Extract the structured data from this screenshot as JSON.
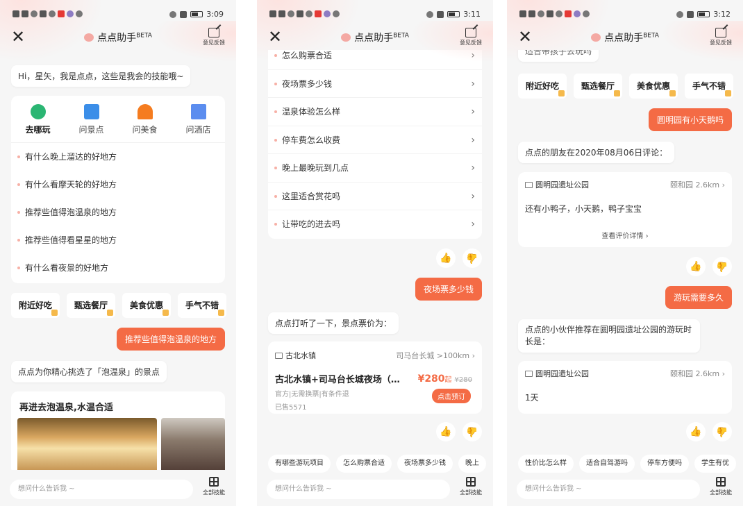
{
  "common": {
    "title": "点点助手",
    "title_sup": "BETA",
    "feedback_label": "意见反馈",
    "input_placeholder": "想问什么告诉我 ~",
    "all_skills_label": "全部技能",
    "close_symbol": "✕",
    "chevron": "›",
    "thumb_up": "👍",
    "thumb_down": "👍"
  },
  "screens": [
    {
      "time": "3:09",
      "greeting": "Hi，星矢，我是点点，这些是我会的技能哦~",
      "tabs": [
        {
          "label": "去哪玩",
          "icon": "compass-icon",
          "color": "#2bb673"
        },
        {
          "label": "问景点",
          "icon": "signpost-icon",
          "color": "#3b8ee8"
        },
        {
          "label": "问美食",
          "icon": "food-dome-icon",
          "color": "#f57c1f"
        },
        {
          "label": "问酒店",
          "icon": "hotel-icon",
          "color": "#5b8def"
        }
      ],
      "questions": [
        "有什么晚上溜达的好地方",
        "有什么看摩天轮的好地方",
        "推荐些值得泡温泉的地方",
        "推荐些值得看星星的地方",
        "有什么看夜景的好地方"
      ],
      "chips": [
        "附近好吃",
        "甄选餐厅",
        "美食优惠",
        "手气不错"
      ],
      "user_msg": "推荐些值得泡温泉的地方",
      "bot_msg": "点点为你精心挑选了「泡温泉」的景点",
      "result_title": "再进去泡温泉,水温合适"
    },
    {
      "time": "3:11",
      "questions": [
        "怎么购票合适",
        "夜场票多少钱",
        "温泉体验怎么样",
        "停车费怎么收费",
        "晚上最晚玩到几点",
        "这里适合赏花吗",
        "让带吃的进去吗"
      ],
      "user_msg": "夜场票多少钱",
      "bot_msg": "点点打听了一下，景点票价为：",
      "ticket": {
        "place": "古北水镇",
        "right_info": "司马台长城   >100km",
        "title": "古北水镇+司马台长城夜场（…",
        "tags": "官方|无需换票|有条件退",
        "sold": "已售5571",
        "price": "¥280",
        "price_suffix": "起",
        "orig_price": "¥280",
        "book_btn": "点击预订"
      },
      "suggestions": [
        "有哪些游玩项目",
        "怎么购票合适",
        "夜场票多少钱",
        "晚上"
      ]
    },
    {
      "time": "3:12",
      "partial_text": "适合带孩子去玩吗",
      "chips": [
        "附近好吃",
        "甄选餐厅",
        "美食优惠",
        "手气不错"
      ],
      "user_msg1": "圆明园有小天鹅吗",
      "bot_msg1": "点点的朋友在2020年08月06日评论：",
      "review": {
        "place": "圆明园遗址公园",
        "right_info": "颐和园   2.6km",
        "body": "还有小鸭子，小天鹅，鸭子宝宝",
        "more": "查看评价详情 ›"
      },
      "user_msg2": "游玩需要多久",
      "bot_msg2": "点点的小伙伴推荐在圆明园遗址公园的游玩时长是：",
      "duration": {
        "place": "圆明园遗址公园",
        "right_info": "颐和园   2.6km",
        "value": "1天"
      },
      "suggestions": [
        "性价比怎么样",
        "适合自驾游吗",
        "停车方便吗",
        "学生有优"
      ]
    }
  ]
}
